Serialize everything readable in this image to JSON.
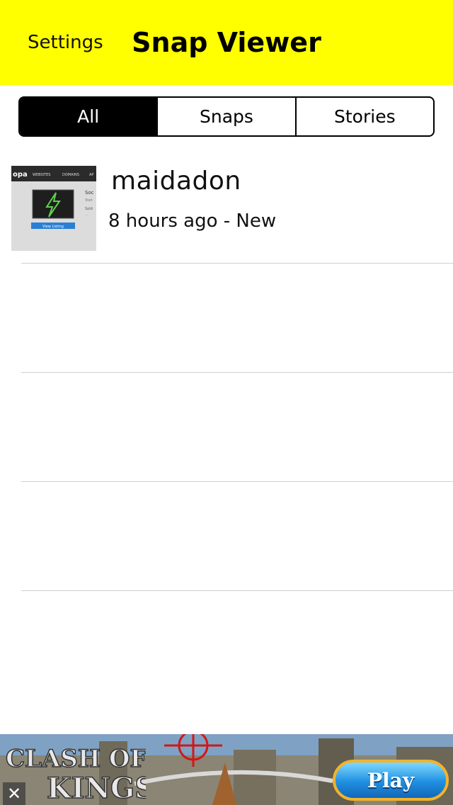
{
  "header": {
    "settings_label": "Settings",
    "title": "Snap Viewer",
    "background_color": "#ffff00"
  },
  "tabs": [
    {
      "label": "All",
      "active": true
    },
    {
      "label": "Snaps",
      "active": false
    },
    {
      "label": "Stories",
      "active": false
    }
  ],
  "snaps": [
    {
      "username": "maidadon",
      "subtitle": "8 hours ago - New",
      "thumbnail": {
        "brand_fragment": "opa",
        "nav_items": [
          "WEBSITES",
          "DOMAINS",
          "AP"
        ],
        "side_text": [
          "Soc",
          "Visit",
          "Sold",
          "..."
        ],
        "button_label": "View Listing",
        "icon": "lightning-bolt-icon"
      }
    }
  ],
  "ad": {
    "brand_line1": "CLASH OF",
    "brand_line2": "KINGS",
    "cta_label": "Play",
    "close_icon": "close-icon"
  }
}
